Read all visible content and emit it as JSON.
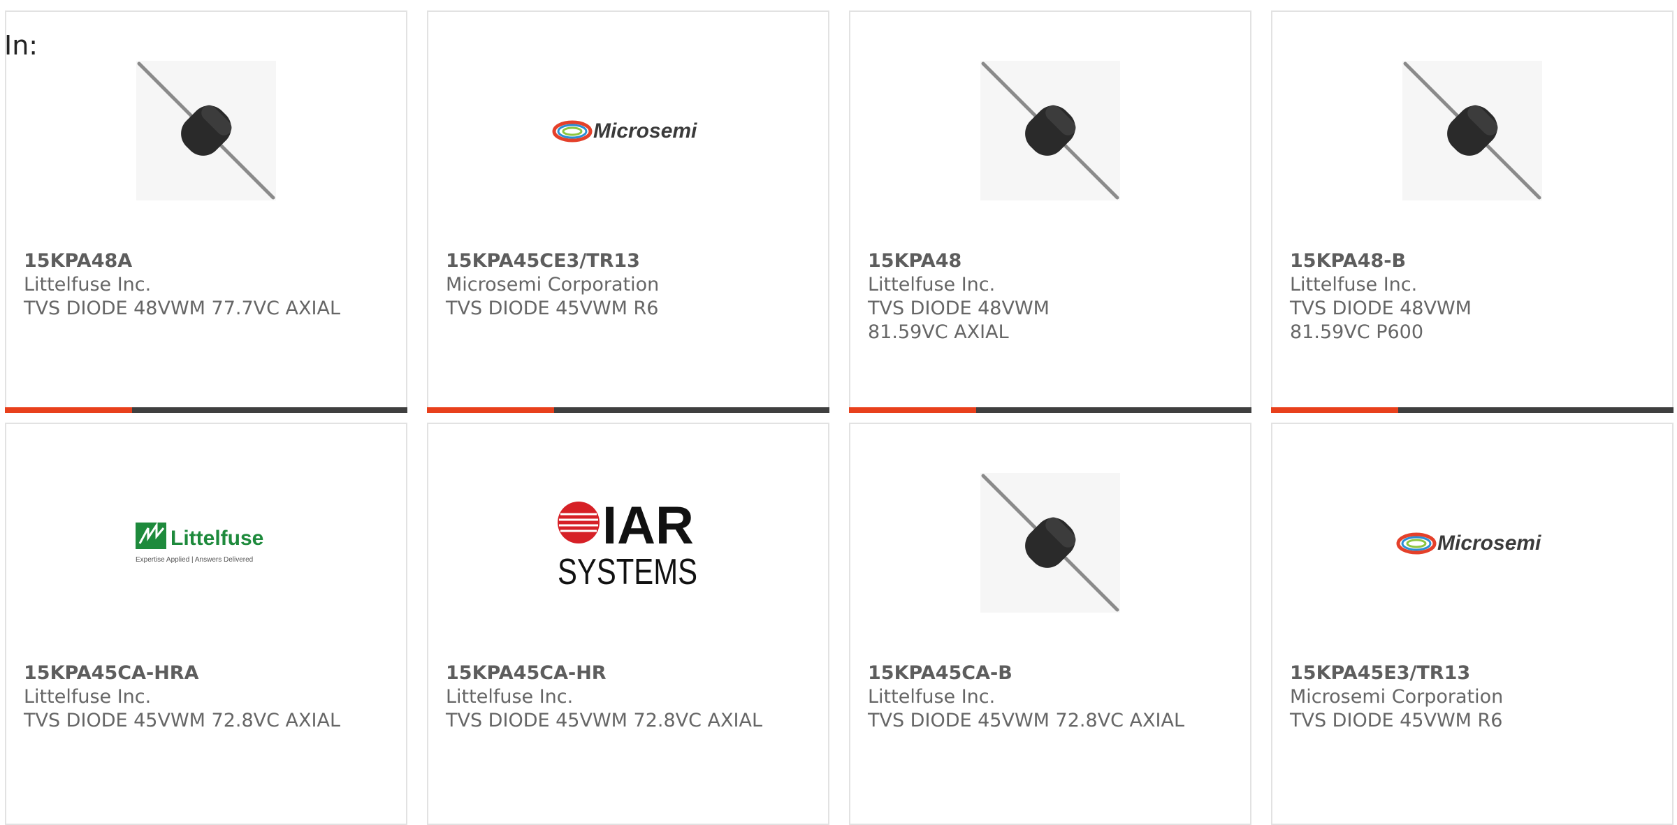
{
  "page": {
    "in_label": "In:"
  },
  "colors": {
    "accent": "#e8401c",
    "bar": "#3f3f3f",
    "littelfuse_green": "#1e8a3c"
  },
  "cards": [
    {
      "part": "15KPA48A",
      "manufacturer": "Littelfuse Inc.",
      "description": "TVS DIODE 48VWM 77.7VC AXIAL",
      "image": "diode-photo"
    },
    {
      "part": "15KPA45CE3/TR13",
      "manufacturer": "Microsemi Corporation",
      "description": "TVS DIODE 45VWM R6",
      "image": "microsemi-logo",
      "logo_text": "Microsemi"
    },
    {
      "part": "15KPA48",
      "manufacturer": "Littelfuse Inc.",
      "description": "TVS DIODE 48VWM 81.59VC AXIAL",
      "image": "diode-photo"
    },
    {
      "part": "15KPA48-B",
      "manufacturer": "Littelfuse Inc.",
      "description": "TVS DIODE 48VWM 81.59VC P600",
      "image": "diode-photo"
    },
    {
      "part": "15KPA45CA-HRA",
      "manufacturer": "Littelfuse Inc.",
      "description": "TVS DIODE 45VWM 72.8VC AXIAL",
      "image": "littelfuse-logo",
      "logo_text": "Littelfuse",
      "logo_tagline": "Expertise Applied | Answers Delivered"
    },
    {
      "part": "15KPA45CA-HR",
      "manufacturer": "Littelfuse Inc.",
      "description": "TVS DIODE 45VWM 72.8VC AXIAL",
      "image": "iar-systems-logo",
      "logo_text": "IAR",
      "logo_subtext": "SYSTEMS"
    },
    {
      "part": "15KPA45CA-B",
      "manufacturer": "Littelfuse Inc.",
      "description": "TVS DIODE 45VWM 72.8VC AXIAL",
      "image": "diode-photo"
    },
    {
      "part": "15KPA45E3/TR13",
      "manufacturer": "Microsemi Corporation",
      "description": "TVS DIODE 45VWM R6",
      "image": "microsemi-logo",
      "logo_text": "Microsemi"
    }
  ]
}
